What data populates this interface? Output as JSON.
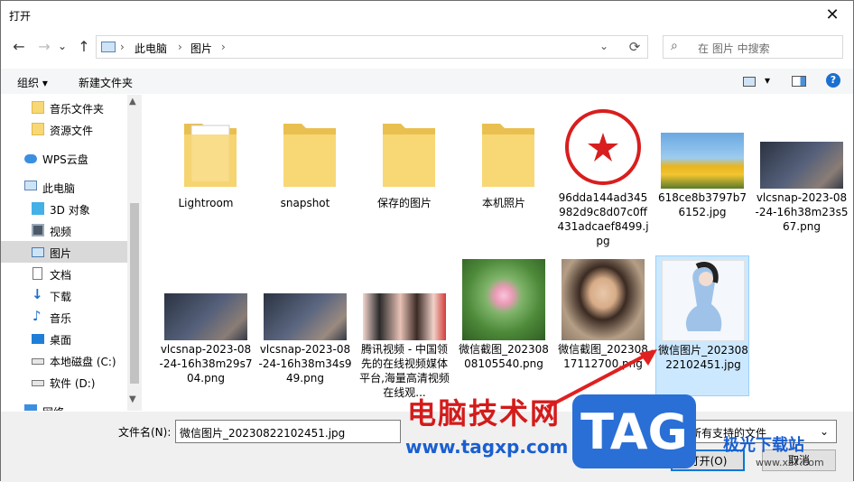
{
  "window": {
    "title": "打开"
  },
  "nav": {
    "back": "←",
    "forward": "→",
    "recent": "⌄",
    "up": "↑",
    "crumbs": [
      "此电脑",
      "图片"
    ],
    "search_placeholder": "在 图片 中搜索"
  },
  "toolbar": {
    "organize": "组织 ▾",
    "new_folder": "新建文件夹"
  },
  "sidebar": {
    "items": [
      {
        "label": "音乐文件夹",
        "icon": "folder-icon"
      },
      {
        "label": "资源文件",
        "icon": "folder-icon"
      },
      {
        "label": "WPS云盘",
        "icon": "cloud-icon"
      },
      {
        "label": "此电脑",
        "icon": "computer-icon"
      },
      {
        "label": "3D 对象",
        "icon": "cube-icon"
      },
      {
        "label": "视频",
        "icon": "video-icon"
      },
      {
        "label": "图片",
        "icon": "pictures-icon",
        "selected": true
      },
      {
        "label": "文档",
        "icon": "document-icon"
      },
      {
        "label": "下载",
        "icon": "download-icon"
      },
      {
        "label": "音乐",
        "icon": "music-icon"
      },
      {
        "label": "桌面",
        "icon": "desktop-icon"
      },
      {
        "label": "本地磁盘 (C:)",
        "icon": "drive-icon"
      },
      {
        "label": "软件 (D:)",
        "icon": "drive-icon"
      },
      {
        "label": "网络",
        "icon": "network-icon"
      }
    ]
  },
  "files": {
    "row1": [
      {
        "name": "Lightroom",
        "kind": "folder"
      },
      {
        "name": "snapshot",
        "kind": "folder"
      },
      {
        "name": "保存的图片",
        "kind": "folder"
      },
      {
        "name": "本机照片",
        "kind": "folder"
      },
      {
        "name": "96dda144ad345982d9c8d07c0ff431adcaef8499.jpg",
        "kind": "seal"
      },
      {
        "name": "618ce8b3797b76152.jpg",
        "kind": "tulips"
      },
      {
        "name": "vlcsnap-2023-08-24-16h38m23s567.png",
        "kind": "bedroom"
      }
    ],
    "row2": [
      {
        "name": "vlcsnap-2023-08-24-16h38m29s704.png",
        "kind": "bedroom"
      },
      {
        "name": "vlcsnap-2023-08-24-16h38m34s949.png",
        "kind": "bedroom"
      },
      {
        "name": "腾讯视频 - 中国领先的在线视频媒体平台,海量高清视频在线观...",
        "kind": "people"
      },
      {
        "name": "微信截图_20230808105540.png",
        "kind": "lotus"
      },
      {
        "name": "微信截图_20230817112700.png",
        "kind": "portrait"
      },
      {
        "name": "微信图片_20230822102451.jpg",
        "kind": "drawing",
        "selected": true
      }
    ]
  },
  "footer": {
    "filename_label": "文件名(N):",
    "filename_value": "微信图片_20230822102451.jpg",
    "filetype": "所有支持的文件",
    "open_label": "打开(O)",
    "cancel_label": "取消"
  },
  "watermark": {
    "site_name": "电脑技术网",
    "site_url": "www.tagxp.com",
    "badge": "TAG",
    "brand": "极光下载站",
    "brand_url": "www.xz7.com"
  },
  "colors": {
    "accent": "#0078d7",
    "selected_bg": "#cce8ff",
    "folder": "#f8d775"
  }
}
